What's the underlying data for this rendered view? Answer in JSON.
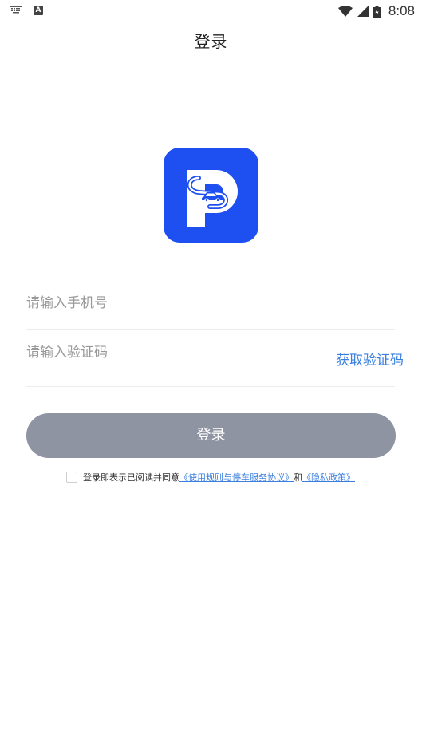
{
  "status_bar": {
    "time": "8:08",
    "icons": [
      "keyboard-icon",
      "a-notification-icon",
      "wifi-icon",
      "cell-signal-icon",
      "battery-icon"
    ]
  },
  "header": {
    "title": "登录"
  },
  "logo": {
    "icon": "parking-car-logo-icon",
    "brand_color": "#1e4ff0"
  },
  "form": {
    "phone_placeholder": "请输入手机号",
    "phone_value": "",
    "code_placeholder": "请输入验证码",
    "code_value": "",
    "get_code_label": "获取验证码",
    "login_label": "登录"
  },
  "agreement": {
    "prefix": "登录即表示已阅读并同意",
    "service_link": "《使用规则与停车服务协议》",
    "conjunction": "和",
    "privacy_link": "《隐私政策》",
    "checked": false
  },
  "colors": {
    "link": "#3a7fe0",
    "button_disabled": "#8f94a3"
  }
}
